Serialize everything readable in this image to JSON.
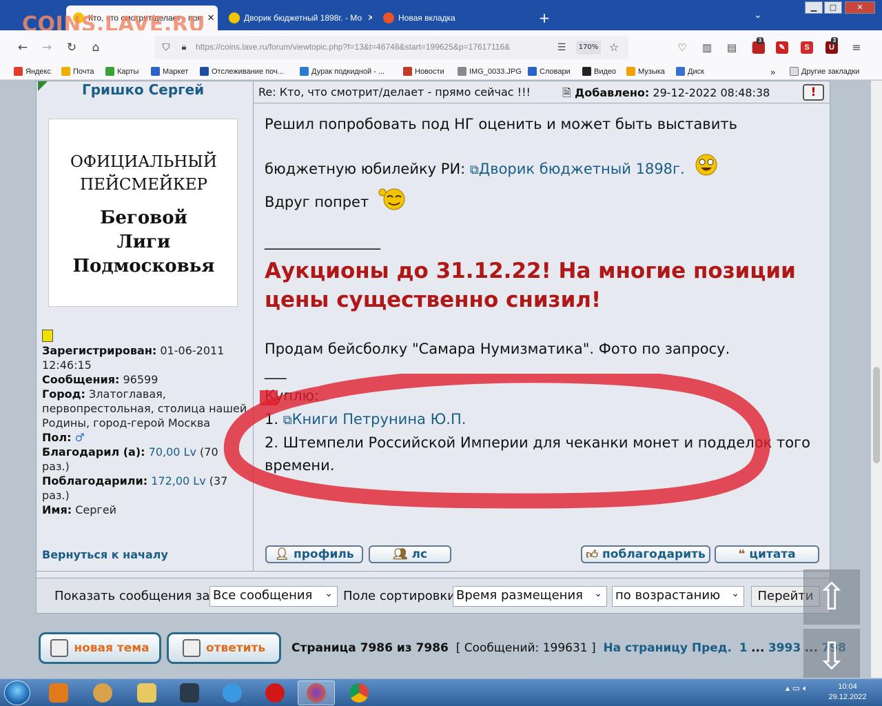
{
  "browser": {
    "watermark": "COINS.LAVE.RU",
    "tabs": [
      {
        "label": "Кто, что смотрит/делает - пря",
        "active": true
      },
      {
        "label": "Дворик бюджетный 1898г. - Мо",
        "active": false
      },
      {
        "label": "Новая вкладка",
        "active": false
      }
    ],
    "url": "https://coins.lave.ru/forum/viewtopic.php?f=13&t=46748&start=199625&p=17617116&",
    "zoom": "170%",
    "extension_badges": [
      "3",
      "3"
    ],
    "bookmarks": [
      {
        "label": "Яндекс",
        "color": "#e23c2c"
      },
      {
        "label": "Почта",
        "color": "#f0b000"
      },
      {
        "label": "Карты",
        "color": "#3aa335"
      },
      {
        "label": "Маркет",
        "color": "#2b64c6"
      },
      {
        "label": "Отслеживание поч...",
        "color": "#1d4fa0"
      },
      {
        "label": "Дурак подкидной - ...",
        "color": "#2a7bd0"
      },
      {
        "label": "Новости",
        "color": "#c23a2a"
      },
      {
        "label": "IMG_0033.JPG",
        "color": "#8a8a8a"
      },
      {
        "label": "Словари",
        "color": "#2b64c6"
      },
      {
        "label": "Видео",
        "color": "#222222"
      },
      {
        "label": "Музыка",
        "color": "#f0a000"
      },
      {
        "label": "Диск",
        "color": "#3a6fd0"
      }
    ],
    "other_bookmarks": "Другие закладки"
  },
  "post": {
    "author": "Гришко Сергей",
    "subject": "Re: Кто, что смотрит/делает - прямо сейчас !!!",
    "added_label": "Добавлено:",
    "added_value": "29-12-2022 08:48:38",
    "report_symbol": "!",
    "avatar_line1": "ОФИЦИАЛЬНЫЙ",
    "avatar_line2": "ПЕЙСМЕЙКЕР",
    "avatar_line3": "Беговой",
    "avatar_line4": "Лиги",
    "avatar_line5": "Подмосковья",
    "profile": {
      "registered_label": "Зарегистрирован:",
      "registered_value": "01-06-2011 12:46:15",
      "messages_label": "Сообщения:",
      "messages_value": "96599",
      "city_label": "Город:",
      "city_value": "Златоглавая, первопрестольная, столица нашей Родины, город-герой Москва",
      "sex_label": "Пол:",
      "sex_symbol": "♂",
      "thanked_label": "Благодарил (а):",
      "thanked_value": "70,00 Lv",
      "thanked_times": "(70 раз.)",
      "was_thanked_label": "Поблагодарили:",
      "was_thanked_value": "172,00 Lv",
      "was_thanked_times": "(37 раз.)",
      "name_label": "Имя:",
      "name_value": "Сергей"
    },
    "back_to_top": "Вернуться к началу",
    "body": {
      "line1": "Решил попробовать под НГ оценить и может быть выставить",
      "line2_prefix": "бюджетную юбилейку РИ:",
      "line2_link": "Дворик бюджетный 1898г.",
      "line3": "Вдруг попрет",
      "separator": "________________",
      "auction": "Аукционы до 31.12.22! На многие позиции цены существенно снизил!",
      "sell": "Продам бейсболку \"Самара Нумизматика\". Фото по запросу.",
      "short_sep": "___",
      "buy_label": "Куплю:",
      "buy1_num": "1.",
      "buy1_link": "Книги Петрунина Ю.П.",
      "buy2": "2. Штемпели Российской Империи для чеканки монет и подделок того",
      "buy2_cont": "времени."
    },
    "buttons": {
      "profile": "профиль",
      "pm": "лс",
      "thank": "поблагодарить",
      "quote": "цитата"
    }
  },
  "sortbar": {
    "show_label": "Показать сообщения за:",
    "show_value": "Все сообщения",
    "sort_label": "Поле сортировки",
    "sort_value": "Время размещения",
    "order_value": "по возрастанию",
    "go": "Перейти"
  },
  "bottom": {
    "new_topic": "новая тема",
    "reply": "ответить",
    "page_info": "Страница 7986 из 7986",
    "messages_info": "[ Сообщений: 199631 ]",
    "goto_label": "На страницу Пред.",
    "page_first": "1",
    "dots": "...",
    "page_a": "3993",
    "dots2": "...",
    "page_b": "798"
  },
  "taskbar": {
    "time": "10:04",
    "date": "29.12.2022"
  }
}
